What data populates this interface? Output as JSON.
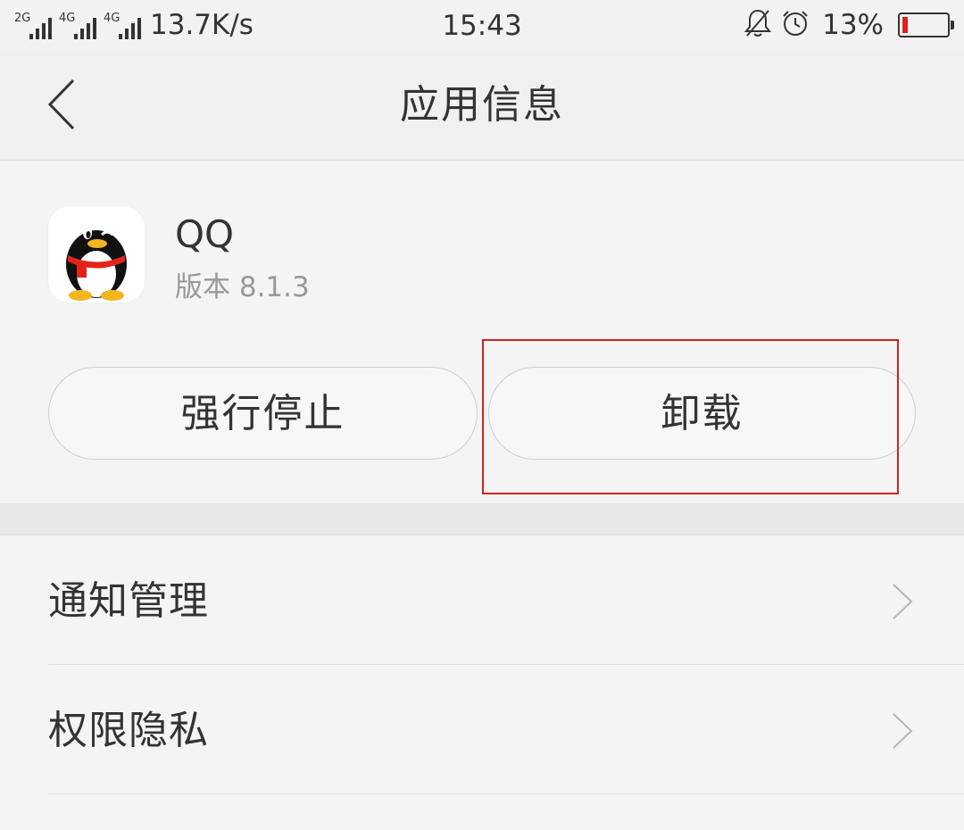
{
  "status_bar": {
    "sim1_label": "2G",
    "sim2_label": "4G",
    "sim3_label": "4G",
    "net_speed": "13.7K/s",
    "time": "15:43",
    "icons": [
      "mute-bell-icon",
      "alarm-icon"
    ],
    "battery_percent_text": "13%",
    "battery_level": 0.13,
    "battery_color": "#e02020"
  },
  "header": {
    "back_icon": "chevron-left-icon",
    "title": "应用信息"
  },
  "app": {
    "icon": "qq-penguin-icon",
    "name": "QQ",
    "version": "版本 8.1.3"
  },
  "actions": {
    "force_stop_label": "强行停止",
    "uninstall_label": "卸载",
    "highlight_color": "#d42020"
  },
  "settings": [
    {
      "label": "通知管理",
      "icon": "chevron-right-icon"
    },
    {
      "label": "权限隐私",
      "icon": "chevron-right-icon"
    }
  ]
}
